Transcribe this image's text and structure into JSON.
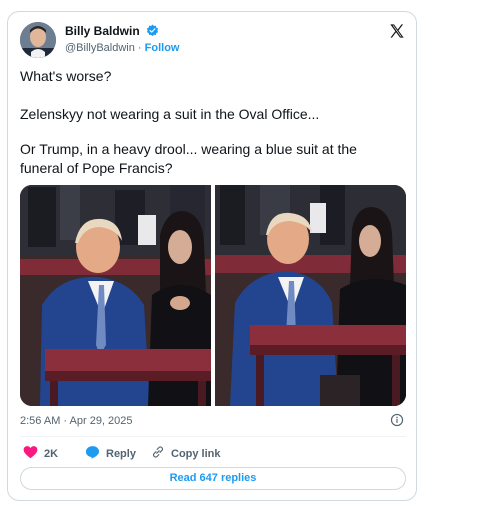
{
  "author": {
    "name": "Billy Baldwin",
    "handle": "@BillyBaldwin",
    "separator": "·",
    "follow_label": "Follow"
  },
  "tweet": {
    "line1": "What's worse?",
    "line2": "Zelenskyy not wearing a suit in the Oval Office...",
    "line3": "Or Trump, in a heavy drool... wearing a blue suit at the funeral of Pope Francis?",
    "timestamp": "2:56 AM · Apr 29, 2025"
  },
  "actions": {
    "likes": "2K",
    "reply_label": "Reply",
    "copy_label": "Copy link",
    "read_replies": "Read 647 replies"
  },
  "colors": {
    "accent": "#1d9bf0",
    "like": "#f91880",
    "suit_blue": "#23458f",
    "bench_red": "#8c2f3c"
  },
  "icons": [
    "verified-badge-icon",
    "x-logo-icon",
    "info-icon",
    "heart-icon",
    "reply-bubble-icon",
    "link-icon"
  ]
}
